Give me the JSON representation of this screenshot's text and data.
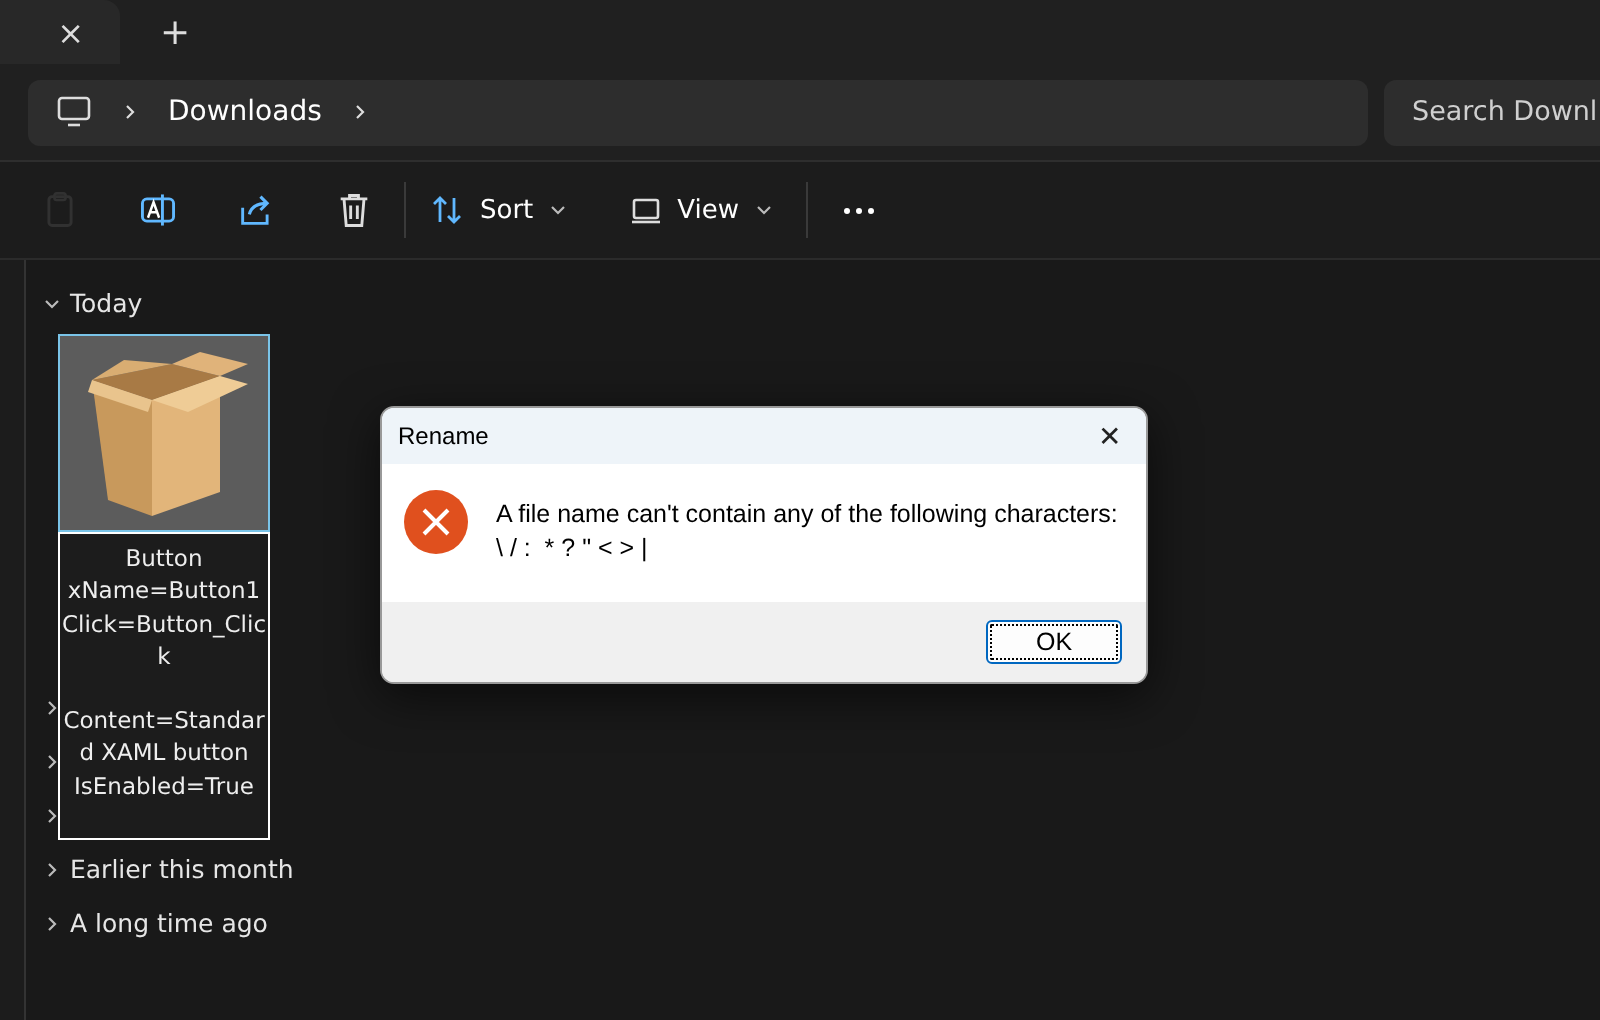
{
  "tab": {
    "close_glyph": "×",
    "new_tab_glyph": "+"
  },
  "address_bar": {
    "breadcrumbs": [
      {
        "label": "Downloads"
      }
    ],
    "search": {
      "placeholder": "Search Downl"
    }
  },
  "toolbar": [
    {
      "kind": "paste",
      "disabled": true
    },
    {
      "kind": "rename",
      "disabled": false
    },
    {
      "kind": "share",
      "disabled": false
    },
    {
      "kind": "delete",
      "disabled": false
    },
    {
      "kind": "separator"
    },
    {
      "kind": "sort",
      "label": "Sort"
    },
    {
      "kind": "view",
      "label": "View"
    },
    {
      "kind": "separator"
    },
    {
      "kind": "more"
    }
  ],
  "groups": [
    {
      "label": "Today",
      "expanded": true,
      "files": [
        {
          "selected": true,
          "name_field": {
            "paragraphs": [
              [
                "Button",
                "xName=Button1",
                "Click=Button_Clic",
                "k"
              ],
              [
                "Content=Standar",
                "d XAML button",
                "IsEnabled=True"
              ]
            ]
          }
        }
      ]
    },
    {
      "expanded": false
    },
    {
      "expanded": false
    },
    {
      "expanded": false
    },
    {
      "label": "Earlier this month",
      "expanded": false
    },
    {
      "label": "A long time ago",
      "expanded": false
    }
  ],
  "dialog": {
    "title": "Rename",
    "close_glyph": "✕",
    "message": "A file name can't contain any of the following characters:",
    "characters": "\\ / :  * ? \" < > |",
    "buttons": [
      {
        "label": "OK",
        "focused": true
      }
    ]
  }
}
